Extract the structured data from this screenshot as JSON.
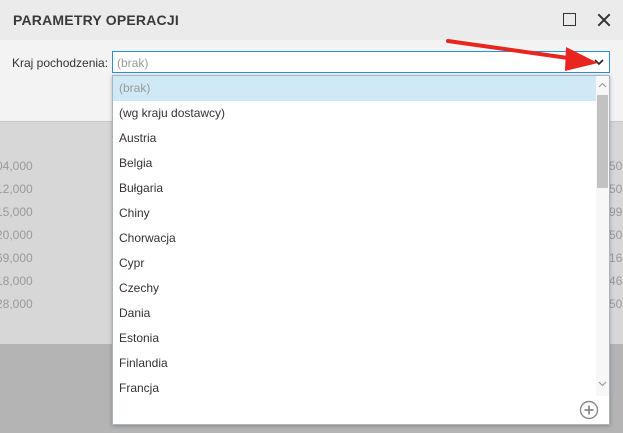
{
  "dialog": {
    "title": "PARAMETRY OPERACJI",
    "maximize_icon": "maximize-icon",
    "close_icon": "close-icon"
  },
  "field": {
    "label": "Kraj pochodzenia:",
    "value": "(brak)",
    "dropdown_icon": "chevron-down-icon"
  },
  "dropdown": {
    "items": [
      "(brak)",
      "(wg kraju dostawcy)",
      "Austria",
      "Belgia",
      "Bułgaria",
      "Chiny",
      "Chorwacja",
      "Cypr",
      "Czechy",
      "Dania",
      "Estonia",
      "Finlandia",
      "Francja"
    ],
    "selected_index": 0,
    "add_icon": "plus-circle-icon"
  },
  "background_grid": {
    "left_values": [
      "04,000",
      "12,000",
      "15,000",
      "20,000",
      "69,000",
      "18,000",
      "28,000"
    ],
    "right_values": [
      "50",
      "50",
      "99",
      "50",
      "16",
      "46",
      "50"
    ]
  },
  "colors": {
    "accent_border": "#2b8fd6",
    "selected_item_bg": "#cfe9f6",
    "annotation_arrow": "#e8261f"
  }
}
